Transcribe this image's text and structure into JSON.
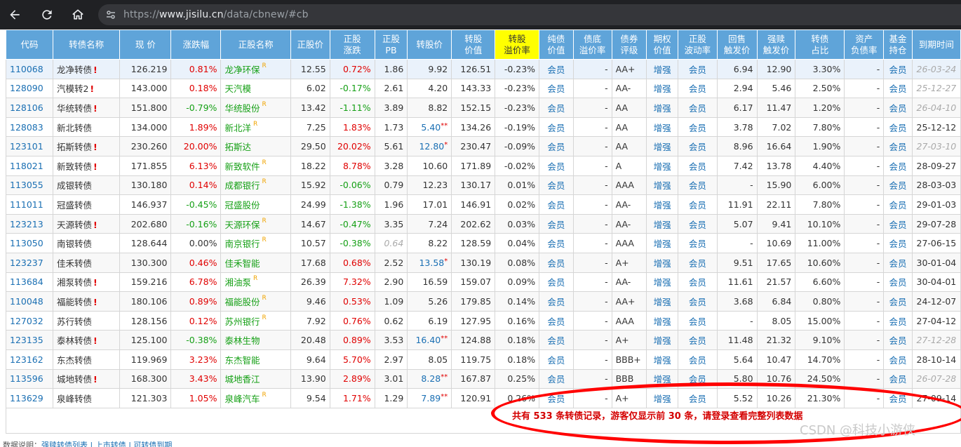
{
  "browser": {
    "url_prefix": "https://",
    "url_host": "www.jisilu.cn",
    "url_path": "/data/cbnew/#cb"
  },
  "table": {
    "headers": [
      "代码",
      "转债名称",
      "现 价",
      "涨跌幅",
      "正股名称",
      "正股价",
      "正股\n涨跌",
      "正股\nPB",
      "转股价",
      "转股\n价值",
      "转股\n溢价率",
      "纯债\n价值",
      "债底\n溢价率",
      "债券\n评级",
      "期权\n价值",
      "正股\n波动率",
      "回售\n触发价",
      "强赎\n触发价",
      "转债\n占比",
      "资产\n负债率",
      "基金\n持仓",
      "到期时间"
    ],
    "highlight_header_index": 10,
    "rows": [
      {
        "code": "110068",
        "name": "龙净转债",
        "excl": "!",
        "price": "126.219",
        "chg": "0.81%",
        "chg_c": "red",
        "stock": "龙净环保",
        "r": "R",
        "sprice": "12.55",
        "schg": "0.72%",
        "schg_c": "red",
        "pb": "1.86",
        "pb_i": false,
        "cvp": "9.92",
        "cvp_c": "",
        "cvp_star": "",
        "cvv": "126.51",
        "prem": "-0.23%",
        "pure": "会员",
        "bond_prem": "-",
        "rating": "AA+",
        "opt": "增强",
        "vol": "会员",
        "put": "6.94",
        "call": "12.90",
        "ratio": "3.30%",
        "debt": "-",
        "fund": "会员",
        "exp": "26-03-24",
        "exp_i": true
      },
      {
        "code": "128090",
        "name": "汽模转2",
        "excl": "!",
        "price": "143.000",
        "chg": "0.18%",
        "chg_c": "red",
        "stock": "天汽模",
        "r": "",
        "sprice": "6.02",
        "schg": "-0.17%",
        "schg_c": "green",
        "pb": "2.61",
        "pb_i": false,
        "cvp": "4.20",
        "cvp_c": "",
        "cvp_star": "",
        "cvv": "143.33",
        "prem": "-0.23%",
        "pure": "会员",
        "bond_prem": "-",
        "rating": "AA-",
        "opt": "增强",
        "vol": "会员",
        "put": "2.94",
        "call": "5.46",
        "ratio": "2.50%",
        "debt": "-",
        "fund": "会员",
        "exp": "25-12-27",
        "exp_i": true
      },
      {
        "code": "128106",
        "name": "华统转债",
        "excl": "!",
        "price": "151.800",
        "chg": "-0.79%",
        "chg_c": "green",
        "stock": "华统股份",
        "r": "R",
        "sprice": "13.42",
        "schg": "-1.11%",
        "schg_c": "green",
        "pb": "3.89",
        "pb_i": false,
        "cvp": "8.82",
        "cvp_c": "",
        "cvp_star": "",
        "cvv": "152.15",
        "prem": "-0.23%",
        "pure": "会员",
        "bond_prem": "-",
        "rating": "AA",
        "opt": "增强",
        "vol": "会员",
        "put": "6.17",
        "call": "11.47",
        "ratio": "1.20%",
        "debt": "-",
        "fund": "会员",
        "exp": "26-04-10",
        "exp_i": true
      },
      {
        "code": "128083",
        "name": "新北转债",
        "excl": "",
        "price": "134.000",
        "chg": "1.89%",
        "chg_c": "red",
        "stock": "新北洋",
        "r": "R",
        "sprice": "7.25",
        "schg": "1.83%",
        "schg_c": "red",
        "pb": "1.73",
        "pb_i": false,
        "cvp": "5.40",
        "cvp_c": "blue",
        "cvp_star": "**",
        "cvv": "134.26",
        "prem": "-0.19%",
        "pure": "会员",
        "bond_prem": "-",
        "rating": "AA",
        "opt": "增强",
        "vol": "会员",
        "put": "3.78",
        "call": "7.02",
        "ratio": "7.80%",
        "debt": "-",
        "fund": "会员",
        "exp": "25-12-12",
        "exp_i": false
      },
      {
        "code": "123101",
        "name": "拓斯转债",
        "excl": "!",
        "price": "230.260",
        "chg": "20.00%",
        "chg_c": "red",
        "stock": "拓斯达",
        "r": "",
        "sprice": "29.50",
        "schg": "20.02%",
        "schg_c": "red",
        "pb": "5.61",
        "pb_i": false,
        "cvp": "12.80",
        "cvp_c": "blue",
        "cvp_star": "*",
        "cvv": "230.47",
        "prem": "-0.09%",
        "pure": "会员",
        "bond_prem": "-",
        "rating": "AA",
        "opt": "增强",
        "vol": "会员",
        "put": "8.96",
        "call": "16.64",
        "ratio": "1.90%",
        "debt": "-",
        "fund": "会员",
        "exp": "27-03-10",
        "exp_i": true
      },
      {
        "code": "118021",
        "name": "新致转债",
        "excl": "!",
        "price": "171.855",
        "chg": "6.13%",
        "chg_c": "red",
        "stock": "新致软件",
        "r": "R",
        "sprice": "18.22",
        "schg": "8.78%",
        "schg_c": "red",
        "pb": "3.28",
        "pb_i": false,
        "cvp": "10.60",
        "cvp_c": "",
        "cvp_star": "",
        "cvv": "171.89",
        "prem": "-0.02%",
        "pure": "会员",
        "bond_prem": "-",
        "rating": "A",
        "opt": "增强",
        "vol": "会员",
        "put": "7.42",
        "call": "13.78",
        "ratio": "4.40%",
        "debt": "-",
        "fund": "会员",
        "exp": "28-09-27",
        "exp_i": false
      },
      {
        "code": "113055",
        "name": "成银转债",
        "excl": "",
        "price": "130.180",
        "chg": "0.14%",
        "chg_c": "red",
        "stock": "成都银行",
        "r": "R",
        "sprice": "15.92",
        "schg": "-0.06%",
        "schg_c": "green",
        "pb": "0.79",
        "pb_i": false,
        "cvp": "12.23",
        "cvp_c": "",
        "cvp_star": "",
        "cvv": "130.17",
        "prem": "0.01%",
        "pure": "会员",
        "bond_prem": "-",
        "rating": "AAA",
        "opt": "增强",
        "vol": "会员",
        "put": "-",
        "call": "15.90",
        "ratio": "6.00%",
        "debt": "-",
        "fund": "会员",
        "exp": "28-03-03",
        "exp_i": false
      },
      {
        "code": "111011",
        "name": "冠盛转债",
        "excl": "",
        "price": "146.937",
        "chg": "-0.45%",
        "chg_c": "green",
        "stock": "冠盛股份",
        "r": "",
        "sprice": "24.99",
        "schg": "-1.38%",
        "schg_c": "green",
        "pb": "1.96",
        "pb_i": false,
        "cvp": "17.01",
        "cvp_c": "",
        "cvp_star": "",
        "cvv": "146.91",
        "prem": "0.02%",
        "pure": "会员",
        "bond_prem": "-",
        "rating": "AA-",
        "opt": "增强",
        "vol": "会员",
        "put": "11.91",
        "call": "22.11",
        "ratio": "7.80%",
        "debt": "-",
        "fund": "会员",
        "exp": "29-01-03",
        "exp_i": false
      },
      {
        "code": "123213",
        "name": "天源转债",
        "excl": "!",
        "price": "202.680",
        "chg": "-0.16%",
        "chg_c": "green",
        "stock": "天源环保",
        "r": "R",
        "sprice": "14.67",
        "schg": "-0.47%",
        "schg_c": "green",
        "pb": "3.35",
        "pb_i": false,
        "cvp": "7.24",
        "cvp_c": "",
        "cvp_star": "",
        "cvv": "202.62",
        "prem": "0.03%",
        "pure": "会员",
        "bond_prem": "-",
        "rating": "AA-",
        "opt": "增强",
        "vol": "会员",
        "put": "5.07",
        "call": "9.41",
        "ratio": "10.10%",
        "debt": "-",
        "fund": "会员",
        "exp": "29-07-28",
        "exp_i": false
      },
      {
        "code": "113050",
        "name": "南银转债",
        "excl": "",
        "price": "128.644",
        "chg": "0.00%",
        "chg_c": "",
        "stock": "南京银行",
        "r": "R",
        "sprice": "10.57",
        "schg": "-0.38%",
        "schg_c": "green",
        "pb": "0.64",
        "pb_i": true,
        "cvp": "8.22",
        "cvp_c": "",
        "cvp_star": "",
        "cvv": "128.59",
        "prem": "0.04%",
        "pure": "会员",
        "bond_prem": "-",
        "rating": "AAA",
        "opt": "增强",
        "vol": "会员",
        "put": "-",
        "call": "10.69",
        "ratio": "11.00%",
        "debt": "-",
        "fund": "会员",
        "exp": "27-06-15",
        "exp_i": false
      },
      {
        "code": "123237",
        "name": "佳禾转债",
        "excl": "",
        "price": "130.300",
        "chg": "0.46%",
        "chg_c": "red",
        "stock": "佳禾智能",
        "r": "",
        "sprice": "17.68",
        "schg": "0.68%",
        "schg_c": "red",
        "pb": "2.52",
        "pb_i": false,
        "cvp": "13.58",
        "cvp_c": "blue",
        "cvp_star": "*",
        "cvv": "130.19",
        "prem": "0.08%",
        "pure": "会员",
        "bond_prem": "-",
        "rating": "A+",
        "opt": "增强",
        "vol": "会员",
        "put": "9.51",
        "call": "17.65",
        "ratio": "10.60%",
        "debt": "-",
        "fund": "会员",
        "exp": "30-01-04",
        "exp_i": false
      },
      {
        "code": "113684",
        "name": "湘泵转债",
        "excl": "!",
        "price": "159.216",
        "chg": "6.78%",
        "chg_c": "red",
        "stock": "湘油泵",
        "r": "R",
        "sprice": "26.39",
        "schg": "7.32%",
        "schg_c": "red",
        "pb": "2.90",
        "pb_i": false,
        "cvp": "16.59",
        "cvp_c": "",
        "cvp_star": "",
        "cvv": "159.07",
        "prem": "0.09%",
        "pure": "会员",
        "bond_prem": "-",
        "rating": "AA-",
        "opt": "增强",
        "vol": "会员",
        "put": "11.61",
        "call": "21.57",
        "ratio": "6.60%",
        "debt": "-",
        "fund": "会员",
        "exp": "30-04-01",
        "exp_i": false
      },
      {
        "code": "110048",
        "name": "福能转债",
        "excl": "!",
        "price": "180.106",
        "chg": "0.89%",
        "chg_c": "red",
        "stock": "福能股份",
        "r": "R",
        "sprice": "9.46",
        "schg": "0.53%",
        "schg_c": "red",
        "pb": "1.09",
        "pb_i": false,
        "cvp": "5.26",
        "cvp_c": "",
        "cvp_star": "",
        "cvv": "179.85",
        "prem": "0.14%",
        "pure": "会员",
        "bond_prem": "-",
        "rating": "AA+",
        "opt": "增强",
        "vol": "会员",
        "put": "3.68",
        "call": "6.84",
        "ratio": "0.80%",
        "debt": "-",
        "fund": "会员",
        "exp": "24-12-07",
        "exp_i": false
      },
      {
        "code": "127032",
        "name": "苏行转债",
        "excl": "",
        "price": "128.156",
        "chg": "0.12%",
        "chg_c": "red",
        "stock": "苏州银行",
        "r": "R",
        "sprice": "7.92",
        "schg": "0.76%",
        "schg_c": "red",
        "pb": "0.62",
        "pb_i": false,
        "cvp": "6.19",
        "cvp_c": "",
        "cvp_star": "",
        "cvv": "127.95",
        "prem": "0.16%",
        "pure": "会员",
        "bond_prem": "-",
        "rating": "AAA",
        "opt": "增强",
        "vol": "会员",
        "put": "-",
        "call": "8.05",
        "ratio": "15.00%",
        "debt": "-",
        "fund": "会员",
        "exp": "27-04-12",
        "exp_i": false
      },
      {
        "code": "123135",
        "name": "泰林转债",
        "excl": "!",
        "price": "125.100",
        "chg": "-0.38%",
        "chg_c": "green",
        "stock": "泰林生物",
        "r": "",
        "sprice": "20.48",
        "schg": "0.89%",
        "schg_c": "red",
        "pb": "3.53",
        "pb_i": false,
        "cvp": "16.40",
        "cvp_c": "blue",
        "cvp_star": "**",
        "cvv": "124.88",
        "prem": "0.18%",
        "pure": "会员",
        "bond_prem": "-",
        "rating": "A+",
        "opt": "增强",
        "vol": "会员",
        "put": "11.48",
        "call": "21.32",
        "ratio": "9.10%",
        "debt": "-",
        "fund": "会员",
        "exp": "27-12-28",
        "exp_i": true
      },
      {
        "code": "123162",
        "name": "东杰转债",
        "excl": "",
        "price": "119.969",
        "chg": "3.23%",
        "chg_c": "red",
        "stock": "东杰智能",
        "r": "",
        "sprice": "9.64",
        "schg": "5.70%",
        "schg_c": "red",
        "pb": "2.97",
        "pb_i": false,
        "cvp": "8.05",
        "cvp_c": "",
        "cvp_star": "",
        "cvv": "119.75",
        "prem": "0.18%",
        "pure": "会员",
        "bond_prem": "-",
        "rating": "BBB+",
        "opt": "增强",
        "vol": "会员",
        "put": "5.64",
        "call": "10.47",
        "ratio": "14.70%",
        "debt": "-",
        "fund": "会员",
        "exp": "28-10-14",
        "exp_i": false
      },
      {
        "code": "113596",
        "name": "城地转债",
        "excl": "!",
        "price": "168.300",
        "chg": "3.43%",
        "chg_c": "red",
        "stock": "城地香江",
        "r": "",
        "sprice": "13.90",
        "schg": "2.89%",
        "schg_c": "red",
        "pb": "3.01",
        "pb_i": false,
        "cvp": "8.28",
        "cvp_c": "blue",
        "cvp_star": "**",
        "cvv": "167.87",
        "prem": "0.25%",
        "pure": "会员",
        "bond_prem": "-",
        "rating": "BBB",
        "opt": "增强",
        "vol": "会员",
        "put": "5.80",
        "call": "10.76",
        "ratio": "24.50%",
        "debt": "-",
        "fund": "会员",
        "exp": "26-07-28",
        "exp_i": true
      },
      {
        "code": "113629",
        "name": "泉峰转债",
        "excl": "",
        "price": "121.303",
        "chg": "1.05%",
        "chg_c": "red",
        "stock": "泉峰汽车",
        "r": "R",
        "sprice": "9.54",
        "schg": "1.71%",
        "schg_c": "red",
        "pb": "1.29",
        "pb_i": false,
        "cvp": "7.89",
        "cvp_c": "blue",
        "cvp_star": "**",
        "cvv": "120.91",
        "prem": "0.26%",
        "pure": "会员",
        "bond_prem": "-",
        "rating": "A+",
        "opt": "增强",
        "vol": "会员",
        "put": "5.52",
        "call": "10.26",
        "ratio": "21.30%",
        "debt": "-",
        "fund": "会员",
        "exp": "27-09-14",
        "exp_i": false
      }
    ]
  },
  "notice": "共有 533 条转债记录，游客仅显示前 30 条，请登录查看完整列表数据",
  "watermark": "CSDN @科技小游侠",
  "bottom_note": {
    "prefix": "数据说明：",
    "links": "强赎转债列表  |  上市转债  |  可转债到期"
  },
  "colors": {
    "header_bg": "#5fa4d9",
    "highlight_header": "#ffff00",
    "red": "#e00000",
    "green": "#16a016",
    "blue": "#1a6fb3",
    "circle": "#ff0000"
  }
}
